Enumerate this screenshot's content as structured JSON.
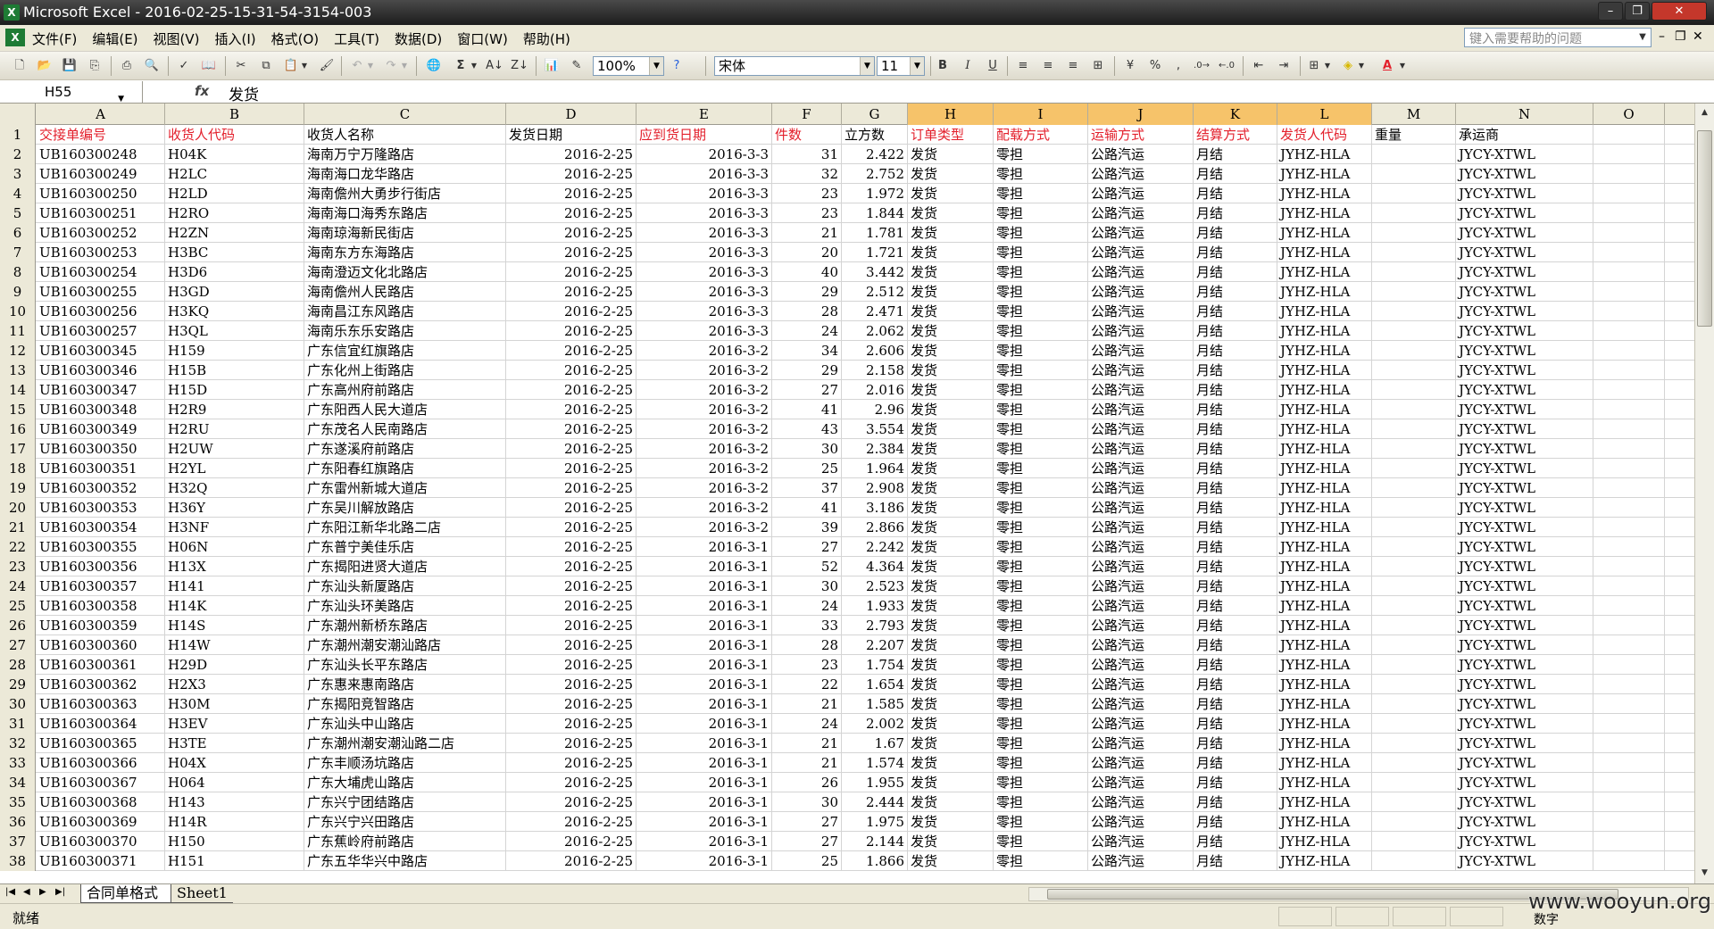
{
  "window": {
    "title": "Microsoft Excel - 2016-02-25-15-31-54-3154-003"
  },
  "menus": [
    "文件(F)",
    "编辑(E)",
    "视图(V)",
    "插入(I)",
    "格式(O)",
    "工具(T)",
    "数据(D)",
    "窗口(W)",
    "帮助(H)"
  ],
  "help_placeholder": "键入需要帮助的问题",
  "toolbar": {
    "zoom": "100%",
    "font": "宋体",
    "font_size": "11",
    "bold": "B",
    "italic": "I",
    "underline": "U",
    "percent": "%",
    "comma": ","
  },
  "formula_bar": {
    "name_box": "H55",
    "fx": "fx",
    "content": "发货"
  },
  "columns": [
    "A",
    "B",
    "C",
    "D",
    "E",
    "F",
    "G",
    "H",
    "I",
    "J",
    "K",
    "L",
    "M",
    "N",
    "O"
  ],
  "header_row": [
    "交接单编号",
    "收货人代码",
    "收货人名称",
    "发货日期",
    "应到货日期",
    "件数",
    "立方数",
    "订单类型",
    "配载方式",
    "运输方式",
    "结算方式",
    "发货人代码",
    "重量",
    "承运商",
    ""
  ],
  "rows": [
    [
      "UB160300248",
      "H04K",
      "海南万宁万隆路店",
      "2016-2-25",
      "2016-3-3",
      "31",
      "2.422",
      "发货",
      "零担",
      "公路汽运",
      "月结",
      "JYHZ-HLA",
      "",
      "JYCY-XTWL"
    ],
    [
      "UB160300249",
      "H2LC",
      "海南海口龙华路店",
      "2016-2-25",
      "2016-3-3",
      "32",
      "2.752",
      "发货",
      "零担",
      "公路汽运",
      "月结",
      "JYHZ-HLA",
      "",
      "JYCY-XTWL"
    ],
    [
      "UB160300250",
      "H2LD",
      "海南儋州大勇步行街店",
      "2016-2-25",
      "2016-3-3",
      "23",
      "1.972",
      "发货",
      "零担",
      "公路汽运",
      "月结",
      "JYHZ-HLA",
      "",
      "JYCY-XTWL"
    ],
    [
      "UB160300251",
      "H2RO",
      "海南海口海秀东路店",
      "2016-2-25",
      "2016-3-3",
      "23",
      "1.844",
      "发货",
      "零担",
      "公路汽运",
      "月结",
      "JYHZ-HLA",
      "",
      "JYCY-XTWL"
    ],
    [
      "UB160300252",
      "H2ZN",
      "海南琼海新民街店",
      "2016-2-25",
      "2016-3-3",
      "21",
      "1.781",
      "发货",
      "零担",
      "公路汽运",
      "月结",
      "JYHZ-HLA",
      "",
      "JYCY-XTWL"
    ],
    [
      "UB160300253",
      "H3BC",
      "海南东方东海路店",
      "2016-2-25",
      "2016-3-3",
      "20",
      "1.721",
      "发货",
      "零担",
      "公路汽运",
      "月结",
      "JYHZ-HLA",
      "",
      "JYCY-XTWL"
    ],
    [
      "UB160300254",
      "H3D6",
      "海南澄迈文化北路店",
      "2016-2-25",
      "2016-3-3",
      "40",
      "3.442",
      "发货",
      "零担",
      "公路汽运",
      "月结",
      "JYHZ-HLA",
      "",
      "JYCY-XTWL"
    ],
    [
      "UB160300255",
      "H3GD",
      "海南儋州人民路店",
      "2016-2-25",
      "2016-3-3",
      "29",
      "2.512",
      "发货",
      "零担",
      "公路汽运",
      "月结",
      "JYHZ-HLA",
      "",
      "JYCY-XTWL"
    ],
    [
      "UB160300256",
      "H3KQ",
      "海南昌江东风路店",
      "2016-2-25",
      "2016-3-3",
      "28",
      "2.471",
      "发货",
      "零担",
      "公路汽运",
      "月结",
      "JYHZ-HLA",
      "",
      "JYCY-XTWL"
    ],
    [
      "UB160300257",
      "H3QL",
      "海南乐东乐安路店",
      "2016-2-25",
      "2016-3-3",
      "24",
      "2.062",
      "发货",
      "零担",
      "公路汽运",
      "月结",
      "JYHZ-HLA",
      "",
      "JYCY-XTWL"
    ],
    [
      "UB160300345",
      "H159",
      "广东信宜红旗路店",
      "2016-2-25",
      "2016-3-2",
      "34",
      "2.606",
      "发货",
      "零担",
      "公路汽运",
      "月结",
      "JYHZ-HLA",
      "",
      "JYCY-XTWL"
    ],
    [
      "UB160300346",
      "H15B",
      "广东化州上街路店",
      "2016-2-25",
      "2016-3-2",
      "29",
      "2.158",
      "发货",
      "零担",
      "公路汽运",
      "月结",
      "JYHZ-HLA",
      "",
      "JYCY-XTWL"
    ],
    [
      "UB160300347",
      "H15D",
      "广东高州府前路店",
      "2016-2-25",
      "2016-3-2",
      "27",
      "2.016",
      "发货",
      "零担",
      "公路汽运",
      "月结",
      "JYHZ-HLA",
      "",
      "JYCY-XTWL"
    ],
    [
      "UB160300348",
      "H2R9",
      "广东阳西人民大道店",
      "2016-2-25",
      "2016-3-2",
      "41",
      "2.96",
      "发货",
      "零担",
      "公路汽运",
      "月结",
      "JYHZ-HLA",
      "",
      "JYCY-XTWL"
    ],
    [
      "UB160300349",
      "H2RU",
      "广东茂名人民南路店",
      "2016-2-25",
      "2016-3-2",
      "43",
      "3.554",
      "发货",
      "零担",
      "公路汽运",
      "月结",
      "JYHZ-HLA",
      "",
      "JYCY-XTWL"
    ],
    [
      "UB160300350",
      "H2UW",
      "广东遂溪府前路店",
      "2016-2-25",
      "2016-3-2",
      "30",
      "2.384",
      "发货",
      "零担",
      "公路汽运",
      "月结",
      "JYHZ-HLA",
      "",
      "JYCY-XTWL"
    ],
    [
      "UB160300351",
      "H2YL",
      "广东阳春红旗路店",
      "2016-2-25",
      "2016-3-2",
      "25",
      "1.964",
      "发货",
      "零担",
      "公路汽运",
      "月结",
      "JYHZ-HLA",
      "",
      "JYCY-XTWL"
    ],
    [
      "UB160300352",
      "H32Q",
      "广东雷州新城大道店",
      "2016-2-25",
      "2016-3-2",
      "37",
      "2.908",
      "发货",
      "零担",
      "公路汽运",
      "月结",
      "JYHZ-HLA",
      "",
      "JYCY-XTWL"
    ],
    [
      "UB160300353",
      "H36Y",
      "广东吴川解放路店",
      "2016-2-25",
      "2016-3-2",
      "41",
      "3.186",
      "发货",
      "零担",
      "公路汽运",
      "月结",
      "JYHZ-HLA",
      "",
      "JYCY-XTWL"
    ],
    [
      "UB160300354",
      "H3NF",
      "广东阳江新华北路二店",
      "2016-2-25",
      "2016-3-2",
      "39",
      "2.866",
      "发货",
      "零担",
      "公路汽运",
      "月结",
      "JYHZ-HLA",
      "",
      "JYCY-XTWL"
    ],
    [
      "UB160300355",
      "H06N",
      "广东普宁美佳乐店",
      "2016-2-25",
      "2016-3-1",
      "27",
      "2.242",
      "发货",
      "零担",
      "公路汽运",
      "月结",
      "JYHZ-HLA",
      "",
      "JYCY-XTWL"
    ],
    [
      "UB160300356",
      "H13X",
      "广东揭阳进贤大道店",
      "2016-2-25",
      "2016-3-1",
      "52",
      "4.364",
      "发货",
      "零担",
      "公路汽运",
      "月结",
      "JYHZ-HLA",
      "",
      "JYCY-XTWL"
    ],
    [
      "UB160300357",
      "H141",
      "广东汕头新厦路店",
      "2016-2-25",
      "2016-3-1",
      "30",
      "2.523",
      "发货",
      "零担",
      "公路汽运",
      "月结",
      "JYHZ-HLA",
      "",
      "JYCY-XTWL"
    ],
    [
      "UB160300358",
      "H14K",
      "广东汕头环美路店",
      "2016-2-25",
      "2016-3-1",
      "24",
      "1.933",
      "发货",
      "零担",
      "公路汽运",
      "月结",
      "JYHZ-HLA",
      "",
      "JYCY-XTWL"
    ],
    [
      "UB160300359",
      "H14S",
      "广东潮州新桥东路店",
      "2016-2-25",
      "2016-3-1",
      "33",
      "2.793",
      "发货",
      "零担",
      "公路汽运",
      "月结",
      "JYHZ-HLA",
      "",
      "JYCY-XTWL"
    ],
    [
      "UB160300360",
      "H14W",
      "广东潮州潮安潮汕路店",
      "2016-2-25",
      "2016-3-1",
      "28",
      "2.207",
      "发货",
      "零担",
      "公路汽运",
      "月结",
      "JYHZ-HLA",
      "",
      "JYCY-XTWL"
    ],
    [
      "UB160300361",
      "H29D",
      "广东汕头长平东路店",
      "2016-2-25",
      "2016-3-1",
      "23",
      "1.754",
      "发货",
      "零担",
      "公路汽运",
      "月结",
      "JYHZ-HLA",
      "",
      "JYCY-XTWL"
    ],
    [
      "UB160300362",
      "H2X3",
      "广东惠来惠南路店",
      "2016-2-25",
      "2016-3-1",
      "22",
      "1.654",
      "发货",
      "零担",
      "公路汽运",
      "月结",
      "JYHZ-HLA",
      "",
      "JYCY-XTWL"
    ],
    [
      "UB160300363",
      "H30M",
      "广东揭阳竞智路店",
      "2016-2-25",
      "2016-3-1",
      "21",
      "1.585",
      "发货",
      "零担",
      "公路汽运",
      "月结",
      "JYHZ-HLA",
      "",
      "JYCY-XTWL"
    ],
    [
      "UB160300364",
      "H3EV",
      "广东汕头中山路店",
      "2016-2-25",
      "2016-3-1",
      "24",
      "2.002",
      "发货",
      "零担",
      "公路汽运",
      "月结",
      "JYHZ-HLA",
      "",
      "JYCY-XTWL"
    ],
    [
      "UB160300365",
      "H3TE",
      "广东潮州潮安潮汕路二店",
      "2016-2-25",
      "2016-3-1",
      "21",
      "1.67",
      "发货",
      "零担",
      "公路汽运",
      "月结",
      "JYHZ-HLA",
      "",
      "JYCY-XTWL"
    ],
    [
      "UB160300366",
      "H04X",
      "广东丰顺汤坑路店",
      "2016-2-25",
      "2016-3-1",
      "21",
      "1.574",
      "发货",
      "零担",
      "公路汽运",
      "月结",
      "JYHZ-HLA",
      "",
      "JYCY-XTWL"
    ],
    [
      "UB160300367",
      "H064",
      "广东大埔虎山路店",
      "2016-2-25",
      "2016-3-1",
      "26",
      "1.955",
      "发货",
      "零担",
      "公路汽运",
      "月结",
      "JYHZ-HLA",
      "",
      "JYCY-XTWL"
    ],
    [
      "UB160300368",
      "H143",
      "广东兴宁团结路店",
      "2016-2-25",
      "2016-3-1",
      "30",
      "2.444",
      "发货",
      "零担",
      "公路汽运",
      "月结",
      "JYHZ-HLA",
      "",
      "JYCY-XTWL"
    ],
    [
      "UB160300369",
      "H14R",
      "广东兴宁兴田路店",
      "2016-2-25",
      "2016-3-1",
      "27",
      "1.975",
      "发货",
      "零担",
      "公路汽运",
      "月结",
      "JYHZ-HLA",
      "",
      "JYCY-XTWL"
    ],
    [
      "UB160300370",
      "H150",
      "广东蕉岭府前路店",
      "2016-2-25",
      "2016-3-1",
      "27",
      "2.144",
      "发货",
      "零担",
      "公路汽运",
      "月结",
      "JYHZ-HLA",
      "",
      "JYCY-XTWL"
    ],
    [
      "UB160300371",
      "H151",
      "广东五华华兴中路店",
      "2016-2-25",
      "2016-3-1",
      "25",
      "1.866",
      "发货",
      "零担",
      "公路汽运",
      "月结",
      "JYHZ-HLA",
      "",
      "JYCY-XTWL"
    ]
  ],
  "sheet_tabs": [
    "合同单格式",
    "Sheet1"
  ],
  "status": {
    "ready": "就绪",
    "num": "数字"
  },
  "watermark": "www.wooyun.org",
  "colors": {
    "header_red": "#e3202c",
    "selected_col": "#f6c36a"
  }
}
